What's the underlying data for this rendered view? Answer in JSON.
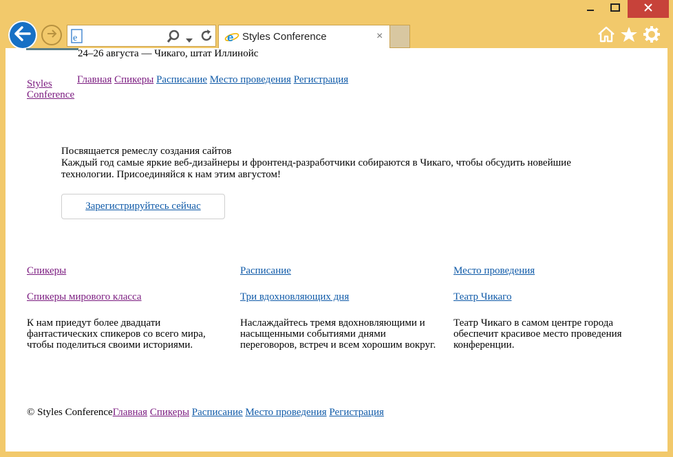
{
  "browser": {
    "tab_title": "Styles Conference",
    "tab_close": "×",
    "icons": [
      "back-arrow-icon",
      "forward-arrow-icon",
      "page-icon",
      "search-icon",
      "dropdown-icon",
      "refresh-icon",
      "ie-icon",
      "home-icon",
      "star-icon",
      "gear-icon",
      "minimize-icon",
      "maximize-icon",
      "close-icon"
    ]
  },
  "header": {
    "date_location": "24–26 августа — Чикаго, штат Иллинойс",
    "logo": "Styles Conference",
    "nav": [
      "Главная",
      "Спикеры",
      "Расписание",
      "Место проведения",
      "Регистрация"
    ]
  },
  "hero": {
    "tagline": "Посвящается ремеслу создания сайтов",
    "text": "Каждый год самые яркие веб-дизайнеры и фронтенд-разработчики собираются в Чикаго, чтобы обсудить новейшие технологии. Присоединяйся к нам этим августом!",
    "cta": "Зарегистрируйтесь сейчас"
  },
  "columns": [
    {
      "heading": "Спикеры",
      "subheading": "Спикеры мирового класса",
      "body": "К нам приедут более двадцати фантастических спикеров со всего мира, чтобы поделиться своими историями."
    },
    {
      "heading": "Расписание",
      "subheading": "Три вдохновляющих дня",
      "body": "Наслаждайтесь тремя вдохновляющими и насыщенными событиями днями переговоров, встреч и всем хорошим вокруг."
    },
    {
      "heading": "Место проведения",
      "subheading": "Театр Чикаго",
      "body": "Театр Чикаго в самом центре города обеспечит красивое место проведения конференции."
    }
  ],
  "footer": {
    "copyright": "© Styles Conference",
    "nav": [
      "Главная",
      "Спикеры",
      "Расписание",
      "Место проведения",
      "Регистрация"
    ]
  },
  "colors": {
    "frame": "#f2c96b",
    "link": "#0f5aa8",
    "visited_link": "#7a1a7f",
    "close_button": "#c7423a",
    "back_button": "#1670c5"
  }
}
